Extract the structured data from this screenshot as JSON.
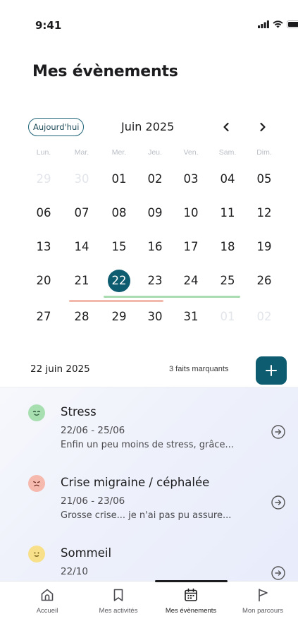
{
  "status_bar": {
    "time": "9:41"
  },
  "page": {
    "title": "Mes évènements"
  },
  "calendar": {
    "today_label": "Aujourd'hui",
    "month_label": "Juin 2025",
    "weekdays": [
      "Lun.",
      "Mar.",
      "Mer.",
      "Jeu.",
      "Ven.",
      "Sam.",
      "Dim."
    ],
    "weeks": [
      [
        "29",
        "30",
        "01",
        "02",
        "03",
        "04",
        "05"
      ],
      [
        "06",
        "07",
        "08",
        "09",
        "10",
        "11",
        "12"
      ],
      [
        "13",
        "14",
        "15",
        "16",
        "17",
        "18",
        "19"
      ],
      [
        "20",
        "21",
        "22",
        "23",
        "24",
        "25",
        "26"
      ],
      [
        "27",
        "28",
        "29",
        "30",
        "31",
        "01",
        "02"
      ]
    ],
    "selected_day": "22",
    "range_colors": {
      "green": "#a9dcb0",
      "red": "#f3b8ac"
    },
    "accent": "#0e5c70"
  },
  "summary": {
    "date": "22 juin 2025",
    "count_label": "3 faits marquants"
  },
  "events": [
    {
      "title": "Stress",
      "dates": "22/06 - 25/06",
      "description": "Enfin un peu moins de stress, grâce...",
      "mood_icon": "happy-face-icon",
      "mood_color": "#a8dfb1"
    },
    {
      "title": "Crise migraine / céphalée",
      "dates": "21/06 - 23/06",
      "description": "Grosse crise... je n'ai pas pu assure...",
      "mood_icon": "sad-face-icon",
      "mood_color": "#f6b9ae"
    },
    {
      "title": "Sommeil",
      "dates": "22/10",
      "description": "",
      "mood_icon": "neutral-face-icon",
      "mood_color": "#f8e08a"
    }
  ],
  "tabs": [
    {
      "label": "Accueil",
      "icon": "home-icon"
    },
    {
      "label": "Mes activités",
      "icon": "bookmark-icon"
    },
    {
      "label": "Mes évènements",
      "icon": "calendar-icon"
    },
    {
      "label": "Mon parcours",
      "icon": "flag-icon"
    }
  ]
}
